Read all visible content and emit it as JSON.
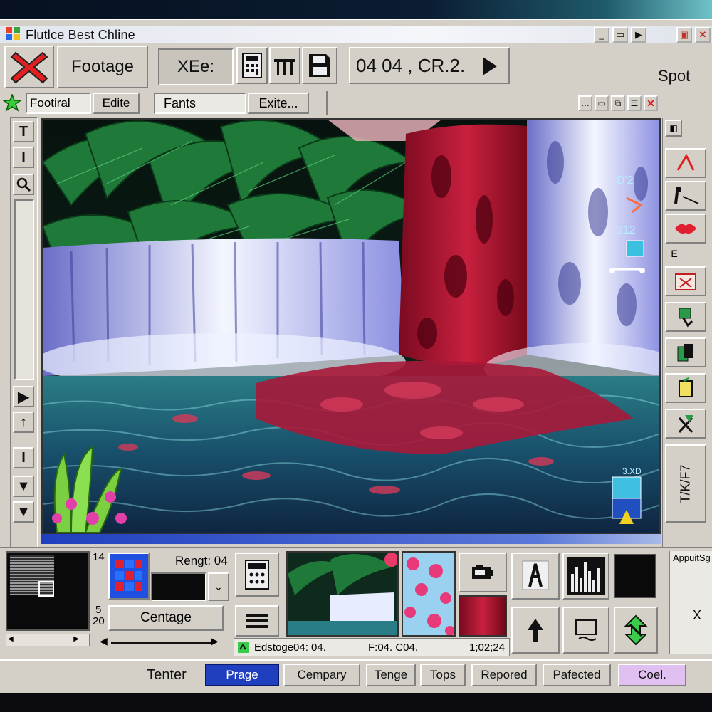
{
  "window": {
    "title": "Flutlce  Best  Chline",
    "controls": [
      "_",
      "▭",
      "▶",
      "▣",
      "✕"
    ]
  },
  "toolbar": {
    "footage_label": "Footage",
    "xee_label": "XEe:",
    "timecode": "04 04 , CR.2.",
    "spot_label": "Spot"
  },
  "subtoolbar": {
    "footiral_label": "Footiral",
    "edite_label": "Edite",
    "fants_label": "Fants",
    "exite_label": "Exite..."
  },
  "left_tools": [
    "T",
    "I",
    "▶",
    "↑",
    "I",
    "▼",
    "▼"
  ],
  "overlay": {
    "label_1": "D'2",
    "label_2": "212",
    "label_3": "3.XD"
  },
  "side": {
    "e_label": "E",
    "vertical_label": "T/K/F7"
  },
  "bottom": {
    "num_14": "14",
    "num_5": "5",
    "num_20": "20",
    "rengt_label": "Rengt: 04",
    "centage_label": "Centage",
    "edstoge_label": "Edstoge04: 04.",
    "f_label": "F:04. C04.",
    "time_label": "1;02;24",
    "apput_label": "AppuitSg",
    "x_label": "X"
  },
  "tabs": {
    "tenter": "Tenter",
    "prage": "Prage",
    "cempary": "Cempary",
    "tenge": "Tenge",
    "tops": "Tops",
    "repored": "Repored",
    "pafected": "Pafected",
    "coel": "Coel."
  },
  "colors": {
    "accent_blue": "#1f3fbf",
    "close_red": "#e02020",
    "face": "#d4d0c8"
  }
}
